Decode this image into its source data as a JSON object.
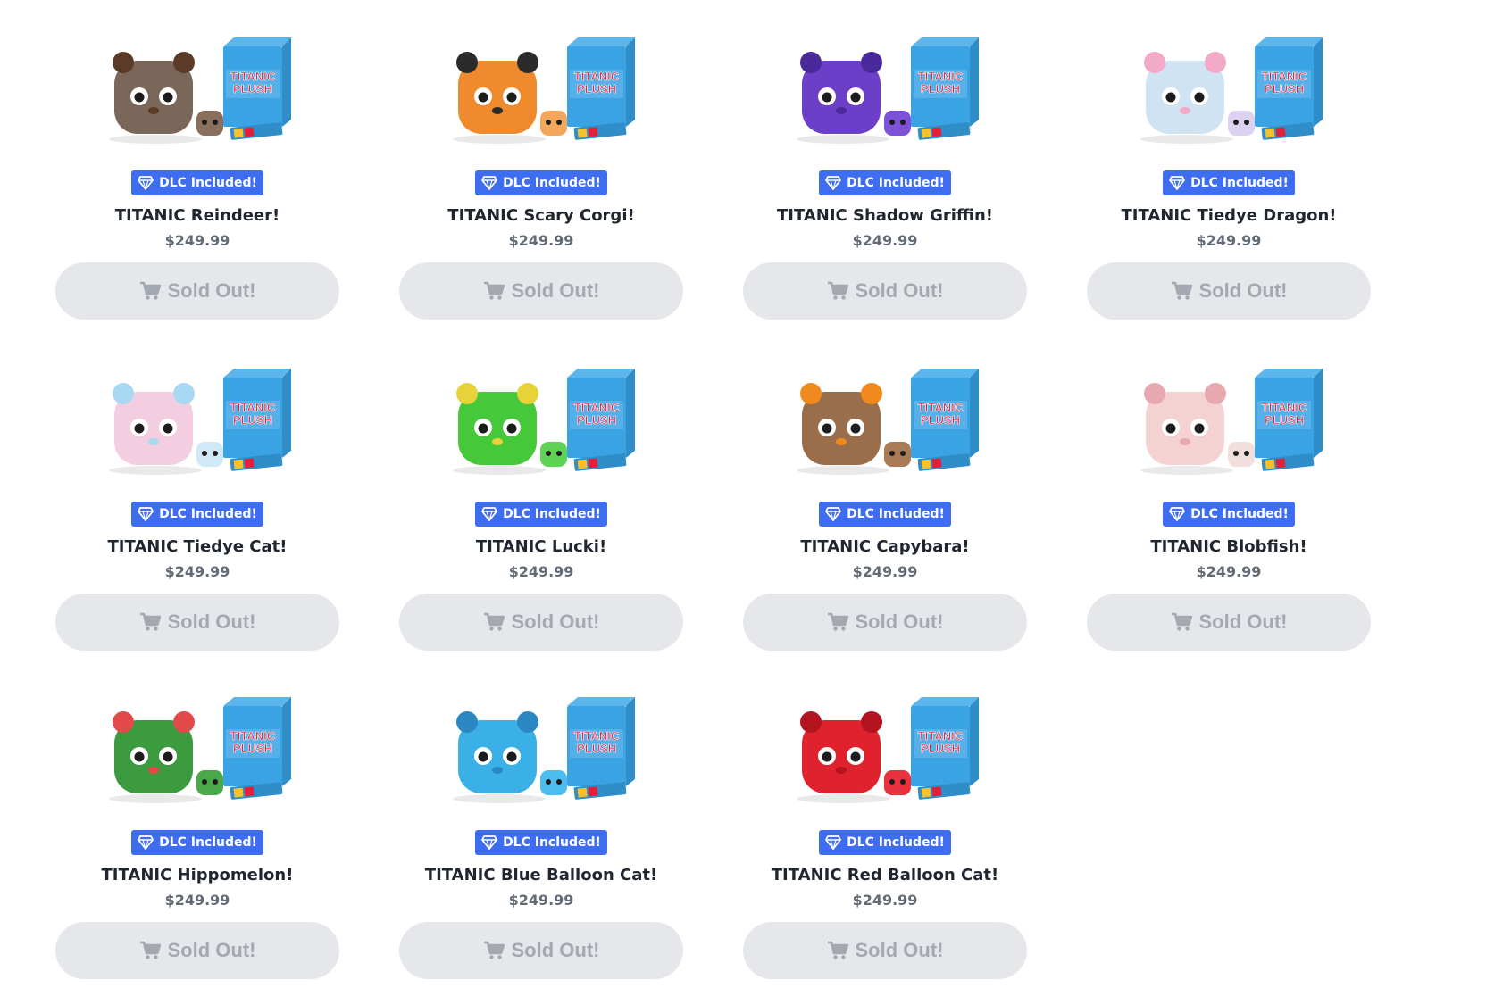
{
  "badge_label": "DLC Included!",
  "price": "$249.99",
  "sold_out_label": "Sold Out!",
  "box_label_line1": "TITANIC",
  "box_label_line2": "PLUSH",
  "colors": {
    "badge_bg": "#3f6df0",
    "button_bg": "#e6e7eb",
    "button_text": "#a4a8b0",
    "title": "#1f2630",
    "price": "#636b76",
    "box_blue": "#3aa3e3",
    "box_text": "#e3203a"
  },
  "icons": {
    "badge": "diamond-gem-icon",
    "button": "shopping-cart-icon"
  },
  "products": [
    {
      "name": "TITANIC Reindeer!",
      "plush_color": "#7b665a",
      "accent": "#5b3b28",
      "mini_color": "#8b6f5d"
    },
    {
      "name": "TITANIC Scary Corgi!",
      "plush_color": "#f08a2e",
      "accent": "#2b2b2b",
      "mini_color": "#f2a75a"
    },
    {
      "name": "TITANIC Shadow Griffin!",
      "plush_color": "#6b3fc7",
      "accent": "#4a2a9a",
      "mini_color": "#7d52d6"
    },
    {
      "name": "TITANIC Tiedye Dragon!",
      "plush_color": "#cfe3f2",
      "accent": "#f3a9c8",
      "mini_color": "#dcd1f0"
    },
    {
      "name": "TITANIC Tiedye Cat!",
      "plush_color": "#f3cde0",
      "accent": "#a9d8f2",
      "mini_color": "#cfe9f7"
    },
    {
      "name": "TITANIC Lucki!",
      "plush_color": "#45c93b",
      "accent": "#e8d23a",
      "mini_color": "#5fd454"
    },
    {
      "name": "TITANIC Capybara!",
      "plush_color": "#9a6e4b",
      "accent": "#f08a1e",
      "mini_color": "#a97c57"
    },
    {
      "name": "TITANIC Blobfish!",
      "plush_color": "#f4d2d2",
      "accent": "#e8a8b0",
      "mini_color": "#f3dede"
    },
    {
      "name": "TITANIC Hippomelon!",
      "plush_color": "#3c9a3f",
      "accent": "#e34a4a",
      "mini_color": "#4aa84b"
    },
    {
      "name": "TITANIC Blue Balloon Cat!",
      "plush_color": "#3ab0e6",
      "accent": "#2a87c2",
      "mini_color": "#4dbcef"
    },
    {
      "name": "TITANIC Red Balloon Cat!",
      "plush_color": "#e0212e",
      "accent": "#b3141f",
      "mini_color": "#e8323e"
    }
  ]
}
